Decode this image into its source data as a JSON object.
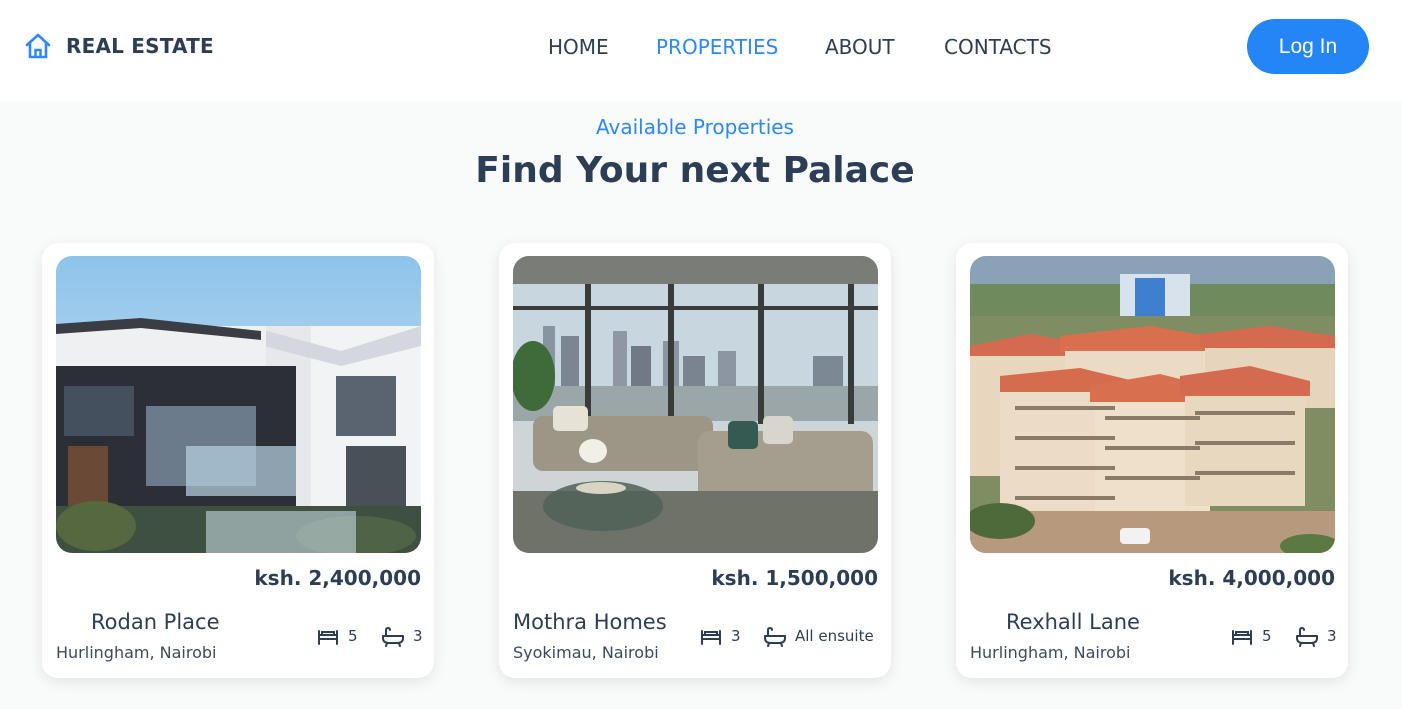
{
  "brand": {
    "name": "REAL ESTATE",
    "icon": "home-icon"
  },
  "nav": {
    "items": [
      "HOME",
      "PROPERTIES",
      "ABOUT",
      "CONTACTS"
    ],
    "active": "PROPERTIES"
  },
  "login_label": "Log In",
  "section": {
    "eyebrow": "Available Properties",
    "title": "Find Your next Palace"
  },
  "colors": {
    "accent": "#2485f6",
    "text": "#2c3e55",
    "background": "#f9fafa"
  },
  "properties": [
    {
      "price": "ksh. 2,400,000",
      "name": "Rodan Place",
      "location": "Hurlingham, Nairobi",
      "beds": "5",
      "baths": "3",
      "image": "modern-house-photo"
    },
    {
      "price": "ksh. 1,500,000",
      "name": "Mothra Homes",
      "location": "Syokimau, Nairobi",
      "beds": "3",
      "baths": "All ensuite",
      "image": "living-room-photo"
    },
    {
      "price": "ksh. 4,000,000",
      "name": "Rexhall Lane",
      "location": "Hurlingham, Nairobi",
      "beds": "5",
      "baths": "3",
      "image": "apartment-complex-photo"
    }
  ]
}
